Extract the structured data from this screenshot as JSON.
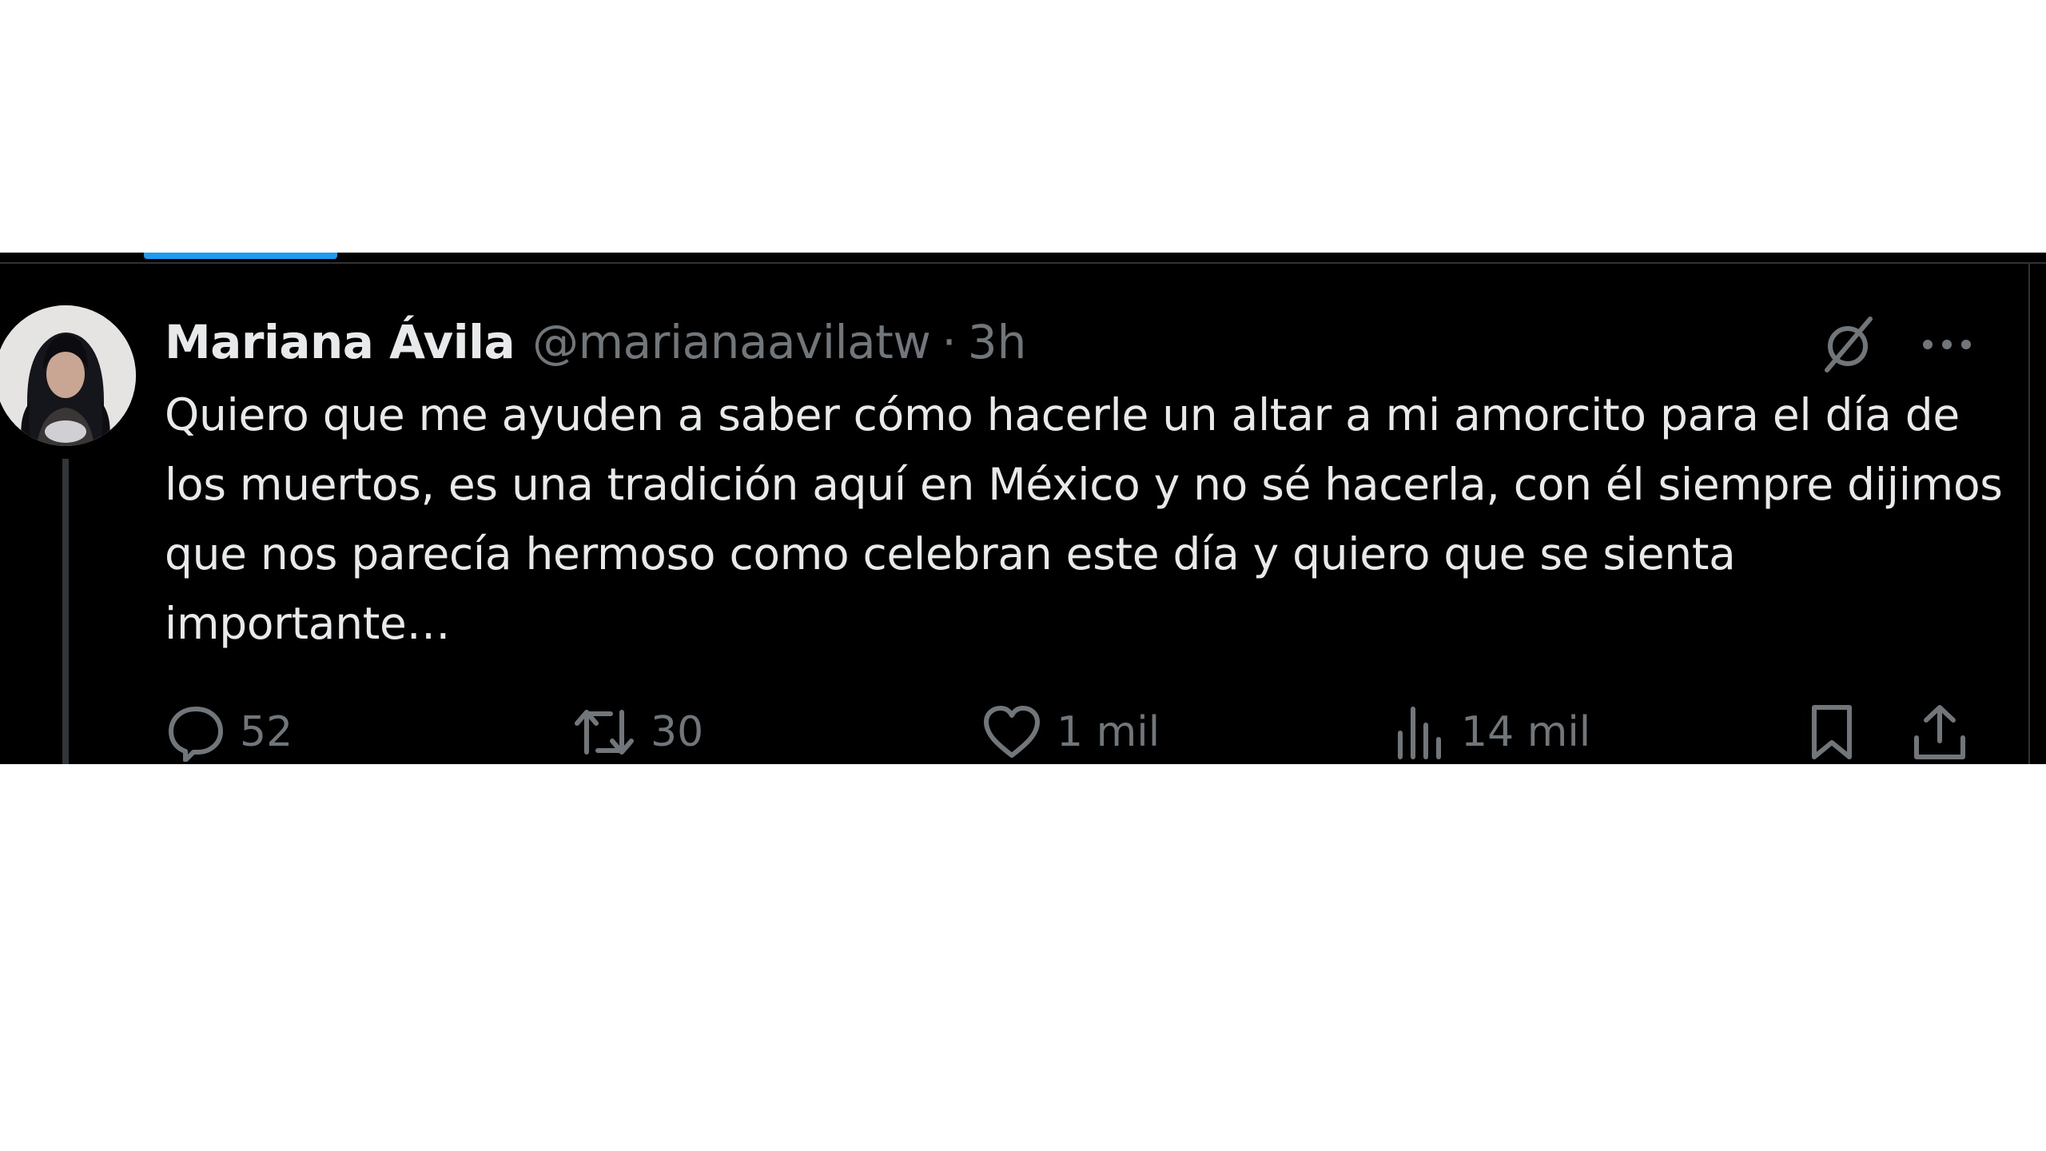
{
  "tweet": {
    "display_name": "Mariana Ávila",
    "handle": "@marianaavilatw",
    "separator": "·",
    "time": "3h",
    "text": "Quiero que me ayuden a saber cómo hacerle un altar a mi amorcito para el día de los muertos, es una tradición aquí en México y no sé hacerla, con él siempre dijimos que nos parecía hermoso como celebran este día y quiero que se sienta importante…",
    "avatar_icon": "user-avatar-photo"
  },
  "header_icons": {
    "grok": "grok-icon",
    "more": "more-icon"
  },
  "actions": {
    "reply_count": "52",
    "repost_count": "30",
    "like_count": "1 mil",
    "views_count": "14 mil",
    "reply_icon": "reply-icon",
    "repost_icon": "repost-icon",
    "like_icon": "heart-icon",
    "views_icon": "views-chart-icon",
    "bookmark_icon": "bookmark-icon",
    "share_icon": "share-icon"
  },
  "colors": {
    "background": "#000000",
    "primary_text": "#e7e9ea",
    "secondary_text": "#71767b",
    "accent": "#1d9bf0",
    "page_background": "#ffffff"
  }
}
